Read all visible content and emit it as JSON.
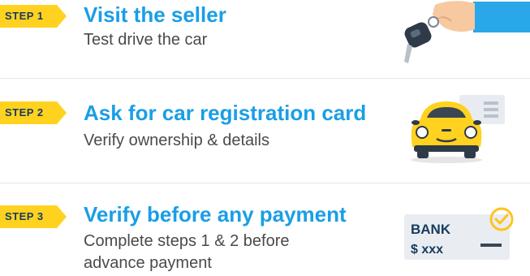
{
  "steps": [
    {
      "badge": "STEP 1",
      "title": "Visit the seller",
      "subtitle": "Test drive the car",
      "icon": "car-key-icon"
    },
    {
      "badge": "STEP 2",
      "title": "Ask for car registration card",
      "subtitle": "Verify ownership & details",
      "icon": "car-registration-icon"
    },
    {
      "badge": "STEP 3",
      "title": "Verify before any payment",
      "subtitle": "Complete steps 1 & 2 before advance payment",
      "icon": "bank-check-icon",
      "card": {
        "bank_label": "BANK",
        "amount_label": "$ xxx"
      }
    }
  ],
  "colors": {
    "badge_bg": "#ffd21f",
    "title": "#1a9ee6",
    "text": "#4a4a4a",
    "car_yellow": "#ffd21f",
    "sleeve_blue": "#2aa7e8"
  }
}
